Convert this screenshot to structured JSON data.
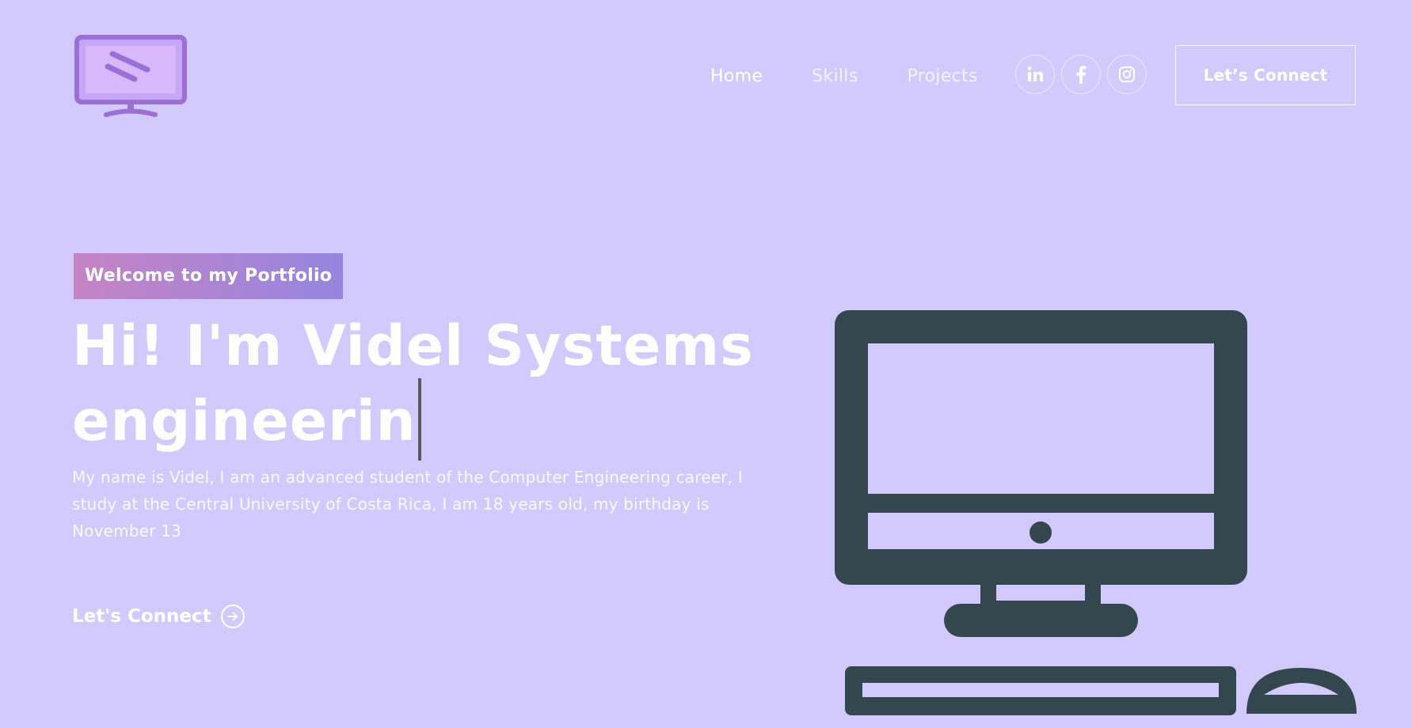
{
  "nav": {
    "logo_icon": "monitor-logo-icon",
    "links": [
      {
        "label": "Home",
        "active": true
      },
      {
        "label": "Skills",
        "active": false
      },
      {
        "label": "Projects",
        "active": false
      }
    ],
    "social": [
      {
        "name": "linkedin-icon",
        "glyph": "in"
      },
      {
        "name": "facebook-icon",
        "glyph": "f"
      },
      {
        "name": "instagram-icon",
        "glyph": ""
      }
    ],
    "connect_button": "Let’s Connect"
  },
  "hero": {
    "tagline": "Welcome to my Portfolio",
    "title_line1": "Hi! I'm Videl Systems",
    "title_line2": "engineerin",
    "description": "My name is Videl, I am an advanced student of the Computer Engineering career, I study at the Central University of Costa Rica, I am 18 years old, my birthday is November 13",
    "cta_label": "Let's Connect",
    "cta_icon": "arrow-right-circle-icon",
    "illustration_icon": "desktop-computer-icon"
  },
  "colors": {
    "background": "#d2c9fd",
    "text": "#ffffff",
    "tagline_gradient_start": "#c584c4",
    "tagline_gradient_end": "#9585e0",
    "illustration": "#34474f",
    "logo_purple": "#9b6fd6"
  }
}
